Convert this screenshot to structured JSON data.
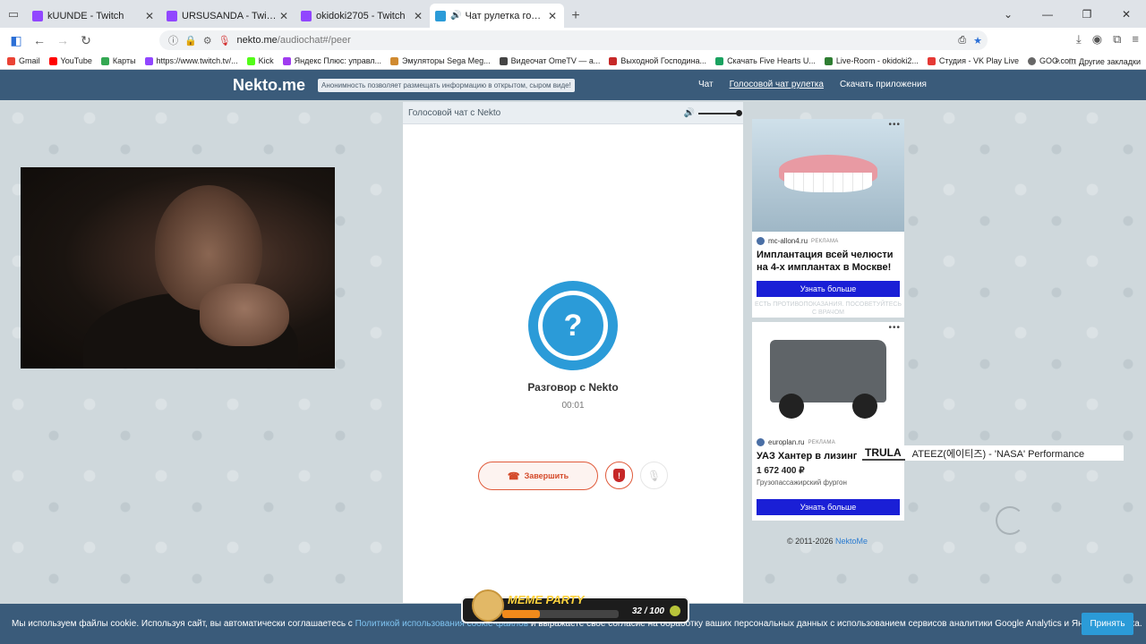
{
  "browser": {
    "tabs": [
      {
        "title": "kUUNDE - Twitch",
        "favicon": "twitch-icon"
      },
      {
        "title": "URSUSANDA - Twitch",
        "favicon": "twitch-icon"
      },
      {
        "title": "okidoki2705 - Twitch",
        "favicon": "twitch-icon"
      },
      {
        "title": "Чат рулетка голосовая — N",
        "favicon": "nekto-icon",
        "active": true
      }
    ],
    "url_host": "nekto.me",
    "url_path": "/audiochat#/peer",
    "bookmarks": [
      "Gmail",
      "YouTube",
      "Карты",
      "https://www.twitch.tv/...",
      "Kick",
      "Яндекс Плюс: управл...",
      "Эмуляторы Sega Meg...",
      "Видеочат OmeTV — а...",
      "Выходной Господина...",
      "Скачать Five Hearts U...",
      "Live-Room - okidoki2...",
      "Студия - VK Play Live",
      "GOG.com"
    ],
    "other_bookmarks": "Другие закладки"
  },
  "site": {
    "logo": "Nekto.me",
    "notice": "Анонимность позволяет размещать информацию в открытом, сыром виде!",
    "nav": [
      "Чат",
      "Голосовой чат рулетка",
      "Скачать приложения"
    ]
  },
  "chat": {
    "header": "Голосовой чат с Nekto",
    "avatar_symbol": "?",
    "title": "Разговор с Nekto",
    "timer": "00:01",
    "end_label": "Завершить",
    "report_symbol": "!"
  },
  "ads": [
    {
      "domain": "mc-allon4.ru",
      "tag": "РЕКЛАМА",
      "headline": "Имплантация всей челюсти на 4-х имплантах в Москве!",
      "cta": "Узнать больше",
      "disclaimer": "ЕСТЬ ПРОТИВОПОКАЗАНИЯ. ПОСОВЕТУЙТЕСЬ С ВРАЧОМ"
    },
    {
      "domain": "europlan.ru",
      "tag": "РЕКЛАМА",
      "headline": "УАЗ Хантер в лизинг",
      "price": "1 672 400 ₽",
      "subtitle": "Грузопассажирский фургон",
      "cta": "Узнать больше"
    }
  ],
  "footer": {
    "copyright": "© 2011-2026",
    "copyright_link": "NektoMe"
  },
  "stream_overlay": {
    "brand": "TRULA",
    "song": "ATEEZ(에이티즈) - 'NASA' Performance",
    "meme_title": "MEME PARTY",
    "meme_count": "32 / 100",
    "meme_progress": 0.32
  },
  "cookie": {
    "text_before": "Мы используем файлы cookie. Используя сайт, вы автоматически соглашаетесь с ",
    "link": "Политикой использования cookie-файлов",
    "text_after": " и выражаете свое согласие на обработку ваших персональных данных с использованием сервисов аналитики Google Analytics и Яндекс Метрика.",
    "accept": "Принять"
  }
}
